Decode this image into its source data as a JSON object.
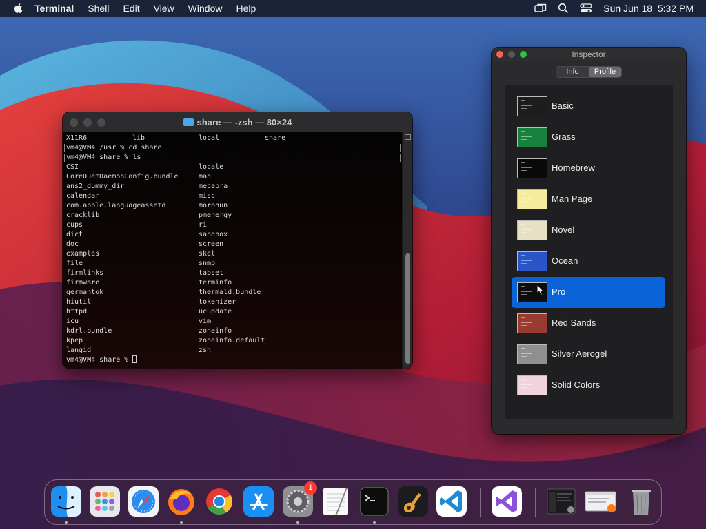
{
  "menubar": {
    "app_name": "Terminal",
    "items": [
      "Shell",
      "Edit",
      "View",
      "Window",
      "Help"
    ],
    "datetime": "Sun Jun 18  5:32 PM",
    "icons": [
      "apple-icon",
      "screen-mirroring-icon",
      "spotlight-search-icon",
      "control-center-icon"
    ]
  },
  "terminal": {
    "title": "share — -zsh — 80×24",
    "lines": [
      {
        "c1": "X11R6",
        "c2": "local",
        "c3": "share",
        "extra": "lib",
        "kind": "plain4"
      },
      {
        "c1": "vm4@VM4 /usr % cd share",
        "kind": "prompt"
      },
      {
        "c1": "vm4@VM4 share % ls",
        "kind": "prompt"
      },
      {
        "c1": "CSI",
        "c2": "locale"
      },
      {
        "c1": "CoreDuetDaemonConfig.bundle",
        "c2": "man"
      },
      {
        "c1": "ans2_dummy_dir",
        "c2": "mecabra"
      },
      {
        "c1": "calendar",
        "c2": "misc"
      },
      {
        "c1": "com.apple.languageassetd",
        "c2": "morphun"
      },
      {
        "c1": "cracklib",
        "c2": "pmenergy"
      },
      {
        "c1": "cups",
        "c2": "ri"
      },
      {
        "c1": "dict",
        "c2": "sandbox"
      },
      {
        "c1": "doc",
        "c2": "screen"
      },
      {
        "c1": "examples",
        "c2": "skel"
      },
      {
        "c1": "file",
        "c2": "snmp"
      },
      {
        "c1": "firmlinks",
        "c2": "tabset"
      },
      {
        "c1": "firmware",
        "c2": "terminfo"
      },
      {
        "c1": "germantok",
        "c2": "thermald.bundle"
      },
      {
        "c1": "hiutil",
        "c2": "tokenizer"
      },
      {
        "c1": "httpd",
        "c2": "ucupdate"
      },
      {
        "c1": "icu",
        "c2": "vim"
      },
      {
        "c1": "kdrl.bundle",
        "c2": "zoneinfo"
      },
      {
        "c1": "kpep",
        "c2": "zoneinfo.default"
      },
      {
        "c1": "langid",
        "c2": "zsh"
      },
      {
        "c1": "vm4@VM4 share % ",
        "kind": "cursor"
      }
    ]
  },
  "inspector": {
    "title": "Inspector",
    "tabs": [
      {
        "label": "Info",
        "active": false
      },
      {
        "label": "Profile",
        "active": true
      }
    ],
    "selected_profile": "Pro",
    "profiles": [
      {
        "name": "Basic",
        "bg": "#1d1d1d"
      },
      {
        "name": "Grass",
        "bg": "#16823d"
      },
      {
        "name": "Homebrew",
        "bg": "#0a0a0a"
      },
      {
        "name": "Man Page",
        "bg": "#f5ec9c"
      },
      {
        "name": "Novel",
        "bg": "#e6e0c5"
      },
      {
        "name": "Ocean",
        "bg": "#2a55c9"
      },
      {
        "name": "Pro",
        "bg": "#0d0d0d"
      },
      {
        "name": "Red Sands",
        "bg": "#9a3b2f"
      },
      {
        "name": "Silver Aerogel",
        "bg": "#8f8f8f"
      },
      {
        "name": "Solid Colors",
        "bg": "#f1d3dc"
      }
    ]
  },
  "dock": {
    "items": [
      {
        "name": "finder",
        "running": true
      },
      {
        "name": "launchpad",
        "running": false
      },
      {
        "name": "safari",
        "running": false
      },
      {
        "name": "firefox",
        "running": true
      },
      {
        "name": "chrome",
        "running": false
      },
      {
        "name": "app-store",
        "running": false
      },
      {
        "name": "system-preferences",
        "running": true,
        "badge": "1"
      },
      {
        "name": "textedit",
        "running": false
      },
      {
        "name": "terminal",
        "running": true
      },
      {
        "name": "garageband",
        "running": false
      },
      {
        "name": "vscode",
        "running": false
      },
      {
        "name": "visual-studio",
        "running": false
      },
      {
        "name": "recent-window-1",
        "running": false
      },
      {
        "name": "recent-window-2",
        "running": false
      },
      {
        "name": "trash",
        "running": false
      }
    ]
  },
  "colors": {
    "selection": "#0a64d8",
    "close_light": "#ff5f57",
    "zoom_light": "#28c840",
    "badge": "#ff3b30"
  }
}
